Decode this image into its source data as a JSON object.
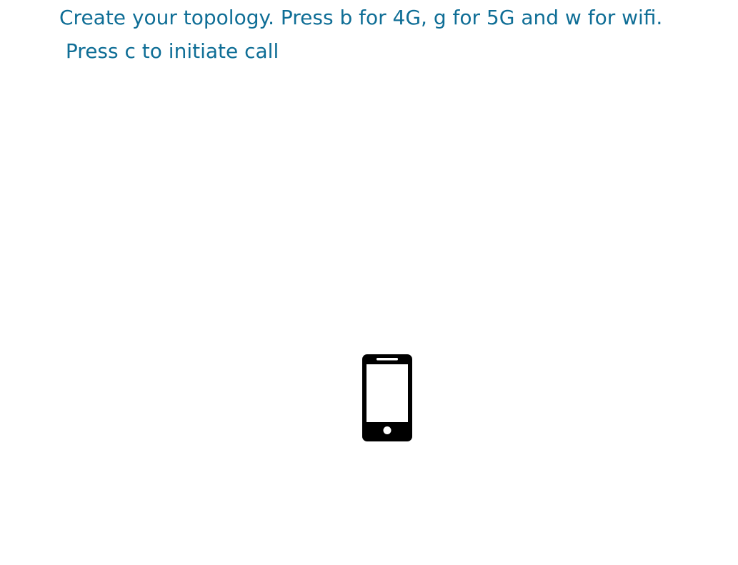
{
  "instructions": {
    "line1": "Create your topology. Press b for 4G, g for 5G and w for wifi.",
    "line2": " Press c to initiate call"
  },
  "colors": {
    "instruction_text": "#0f6e96",
    "device_icon": "#000000",
    "background": "#ffffff"
  },
  "devices": [
    {
      "type": "mobile-phone",
      "icon": "smartphone-icon"
    }
  ]
}
